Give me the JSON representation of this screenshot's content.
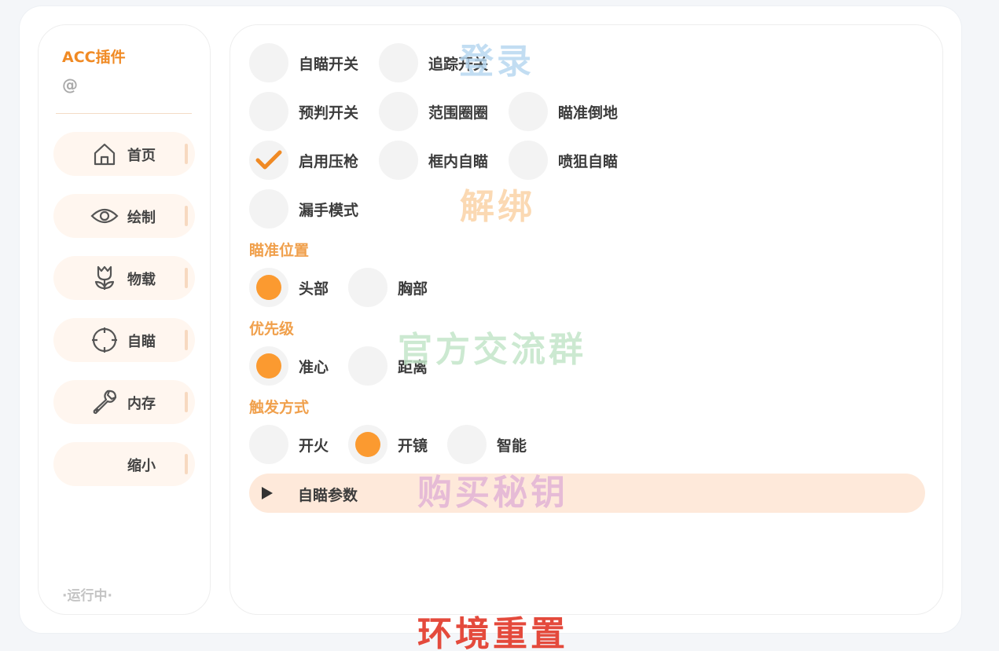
{
  "sidebar": {
    "brand": "ACC插件",
    "user": "@",
    "status": "·运行中·",
    "items": [
      {
        "label": "首页",
        "icon": "home-icon"
      },
      {
        "label": "绘制",
        "icon": "eye-icon"
      },
      {
        "label": "物载",
        "icon": "tulip-icon"
      },
      {
        "label": "自瞄",
        "icon": "crosshair-icon"
      },
      {
        "label": "内存",
        "icon": "wrench-icon"
      },
      {
        "label": "缩小",
        "icon": ""
      }
    ]
  },
  "toggles": {
    "aim_switch": {
      "label": "自瞄开关",
      "checked": false
    },
    "track_switch": {
      "label": "追踪开关",
      "checked": false
    },
    "predict_switch": {
      "label": "预判开关",
      "checked": false
    },
    "range_circle": {
      "label": "范围圈圈",
      "checked": false
    },
    "aim_down": {
      "label": "瞄准倒地",
      "checked": false
    },
    "recoil": {
      "label": "启用压枪",
      "checked": true
    },
    "box_aim": {
      "label": "框内自瞄",
      "checked": false
    },
    "spray_aim": {
      "label": "喷狙自瞄",
      "checked": false
    },
    "leak_mode": {
      "label": "漏手模式",
      "checked": false
    }
  },
  "aim_position": {
    "title": "瞄准位置",
    "options": [
      {
        "label": "头部",
        "selected": true
      },
      {
        "label": "胸部",
        "selected": false
      }
    ]
  },
  "priority": {
    "title": "优先级",
    "options": [
      {
        "label": "准心",
        "selected": true
      },
      {
        "label": "距离",
        "selected": false
      }
    ]
  },
  "trigger": {
    "title": "触发方式",
    "options": [
      {
        "label": "开火",
        "selected": false
      },
      {
        "label": "开镜",
        "selected": true
      },
      {
        "label": "智能",
        "selected": false
      }
    ]
  },
  "expander": {
    "label": "自瞄参数"
  },
  "watermarks": {
    "login": "登录",
    "unbind": "解绑",
    "group": "官方交流群",
    "buy_key": "购买秘钥",
    "reset_env": "环境重置"
  },
  "colors": {
    "accent": "#f08a24",
    "radio_fill": "#fb9a30",
    "nav_bg": "#fff6ef",
    "expander_bg": "#fee9da"
  }
}
